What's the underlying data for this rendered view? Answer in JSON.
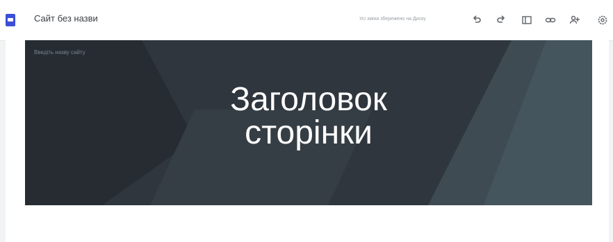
{
  "app": {
    "site_title": "Сайт без назви",
    "status_text": "Усі зміни збережено на Диску"
  },
  "toolbar": {
    "icons": [
      "undo-icon",
      "redo-icon",
      "preview-icon",
      "link-icon",
      "add-person-icon",
      "settings-icon"
    ]
  },
  "banner": {
    "site_name_placeholder": "Введіть назву сайту",
    "title_line1": "Заголовок",
    "title_line2": "сторінки"
  }
}
